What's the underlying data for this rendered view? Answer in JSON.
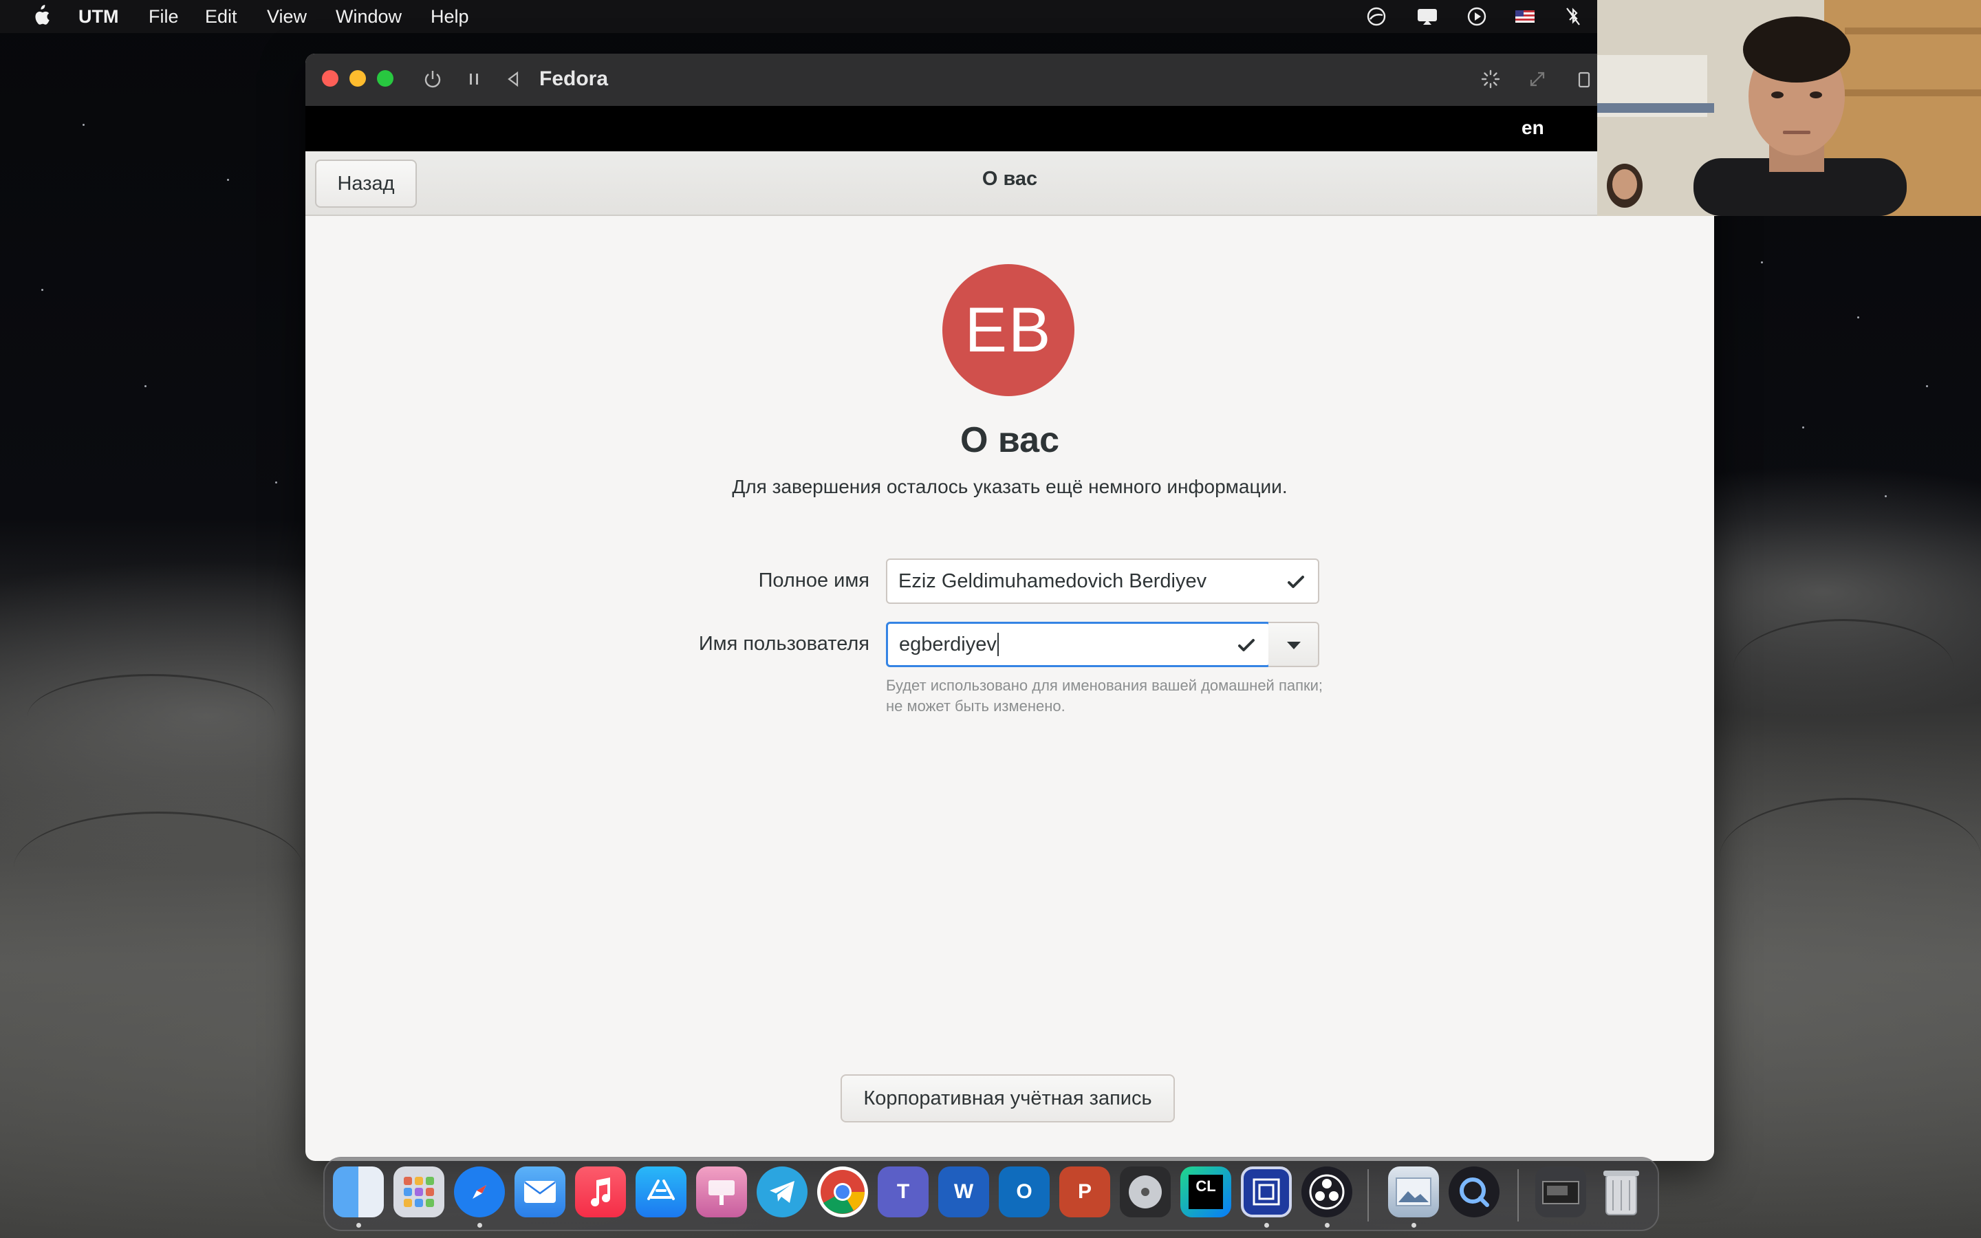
{
  "menubar": {
    "app_name": "UTM",
    "items": [
      "File",
      "Edit",
      "View",
      "Window",
      "Help"
    ]
  },
  "window": {
    "title": "Fedora"
  },
  "gnome": {
    "language_indicator": "en"
  },
  "header": {
    "back_label": "Назад",
    "title": "О вас"
  },
  "main": {
    "avatar_initials": "EB",
    "avatar_color": "#d0504c",
    "heading": "О вас",
    "subtitle": "Для завершения осталось указать ещё немного информации.",
    "full_name": {
      "label": "Полное имя",
      "value": "Eziz Geldimuhamedovich Berdiyev"
    },
    "username": {
      "label": "Имя пользователя",
      "value": "egberdiyev",
      "hint": "Будет использовано для именования вашей домашней папки; не может быть изменено."
    },
    "enterprise_button": "Корпоративная учётная запись"
  },
  "dock": {
    "apps": [
      "Finder",
      "Launchpad",
      "Safari",
      "Mail",
      "Music",
      "App Store",
      "Keynote",
      "Telegram",
      "Chrome",
      "Teams",
      "Word",
      "Outlook",
      "PowerPoint",
      "Disk Utility",
      "CLion",
      "Code Editor",
      "OBS",
      "Preview",
      "QuickTime",
      "Screenshot",
      "Trash"
    ]
  },
  "colors": {
    "accent": "#3584e4",
    "check": "#2e3436",
    "titlebar": "#2f2f30"
  }
}
